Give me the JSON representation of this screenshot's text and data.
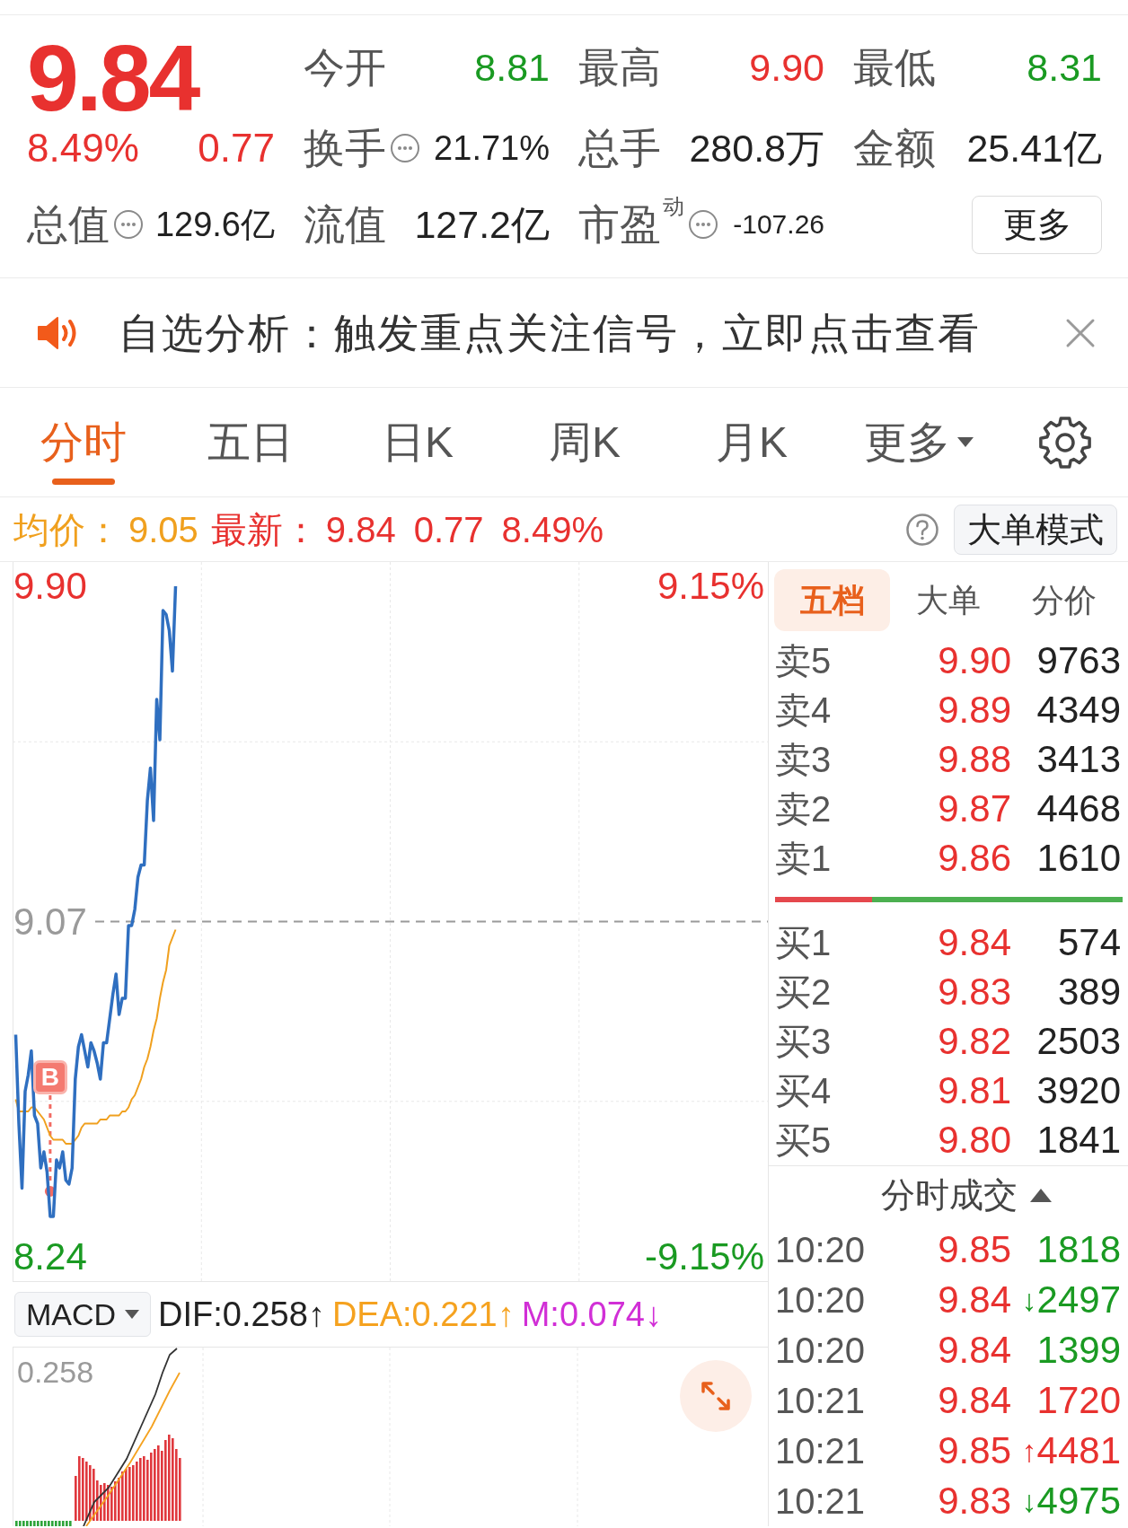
{
  "quote": {
    "price": "9.84",
    "change_pct": "8.49%",
    "change": "0.77",
    "rising": true
  },
  "stats": [
    {
      "label": "今开",
      "info": false,
      "value": "8.81",
      "color": "#1a9a22"
    },
    {
      "label": "最高",
      "info": false,
      "value": "9.90",
      "color": "#e8312f"
    },
    {
      "label": "最低",
      "info": false,
      "value": "8.31",
      "color": "#1a9a22"
    },
    {
      "label": "换手",
      "info": true,
      "value": "21.71%",
      "color": "#222222"
    },
    {
      "label": "总手",
      "info": false,
      "value": "280.8万",
      "color": "#222222"
    },
    {
      "label": "金额",
      "info": false,
      "value": "25.41亿",
      "color": "#222222"
    },
    {
      "label": "总值",
      "info": true,
      "value": "129.6亿",
      "color": "#222222"
    },
    {
      "label": "流值",
      "info": false,
      "value": "127.2亿",
      "color": "#222222"
    },
    {
      "label": "市盈",
      "superscript": "动",
      "info": true,
      "value": "-107.26",
      "color": "#222222"
    }
  ],
  "more_button": "更多",
  "alert": {
    "text": "自选分析：触发重点关注信号，立即点击查看"
  },
  "chart_tabs": [
    {
      "label": "分时",
      "selected": true,
      "dropdown": false
    },
    {
      "label": "五日",
      "selected": false,
      "dropdown": false
    },
    {
      "label": "日K",
      "selected": false,
      "dropdown": false
    },
    {
      "label": "周K",
      "selected": false,
      "dropdown": false
    },
    {
      "label": "月K",
      "selected": false,
      "dropdown": false
    },
    {
      "label": "更多",
      "selected": false,
      "dropdown": true
    }
  ],
  "summary": {
    "average": "9.05",
    "latest": "9.84",
    "change": "0.77",
    "change_pct": "8.49%",
    "mode_button": "大单模式"
  },
  "price_chart": {
    "right_ticks": [
      "9.15%",
      "-9.15%"
    ],
    "chart_data": {
      "type": "line",
      "categories": [
        null,
        null,
        null,
        null,
        null,
        null,
        null,
        null,
        null,
        null,
        null,
        null,
        null,
        null,
        null,
        null,
        null,
        null,
        null,
        null,
        null,
        null,
        null,
        null,
        null,
        null,
        null,
        null,
        null,
        null,
        null,
        null,
        null,
        null,
        null,
        null,
        null,
        null,
        null,
        null,
        null,
        null,
        null,
        null,
        null,
        null,
        null,
        null,
        null,
        null,
        null,
        null,
        null,
        null,
        null,
        null,
        null,
        null,
        null,
        null,
        null,
        null,
        null,
        null,
        null,
        null,
        null,
        null,
        null,
        null,
        null,
        null,
        null,
        null,
        null,
        null,
        null,
        null,
        null,
        null,
        null,
        null,
        null,
        null,
        null,
        null,
        null,
        null,
        null,
        null,
        null,
        null,
        null,
        null,
        null,
        null,
        null,
        null,
        null,
        null,
        null,
        null,
        null,
        null,
        null,
        null,
        null,
        null,
        null,
        null,
        null,
        null,
        null,
        null,
        null,
        null,
        null,
        null,
        null,
        null,
        null,
        null,
        null,
        null,
        null,
        null,
        null,
        null,
        null,
        null,
        null,
        null,
        null,
        null,
        null,
        null,
        null,
        null,
        null,
        null,
        null,
        null,
        null,
        null,
        null,
        null,
        null,
        null,
        null,
        null,
        null,
        null,
        null,
        null,
        null,
        null,
        null,
        null,
        null,
        null,
        null,
        null,
        null,
        null,
        null,
        null,
        null,
        null,
        null,
        null,
        null,
        null,
        null,
        null,
        null,
        null,
        null,
        null,
        null,
        null,
        null,
        null,
        null,
        null,
        null,
        null,
        null,
        null,
        null,
        null,
        null,
        null,
        null,
        null,
        null,
        null,
        null,
        null,
        null,
        null,
        null,
        null,
        null,
        null,
        null,
        null,
        null,
        null,
        null,
        null,
        null,
        null,
        null,
        null,
        null,
        null,
        null,
        null,
        null,
        null,
        null,
        null,
        null,
        null,
        null,
        null,
        null,
        null,
        null,
        null,
        null,
        null,
        null,
        null,
        null,
        null,
        null,
        null,
        null,
        null
      ],
      "ylim": [
        8.18,
        9.96
      ],
      "yticks": [
        {
          "value": 8.24,
          "label": "8.24"
        },
        {
          "value": 9.07,
          "label": "9.07"
        },
        {
          "value": 9.9,
          "label": "9.90"
        }
      ],
      "ref_lines": [
        {
          "axis": "y",
          "value": 9.07
        }
      ],
      "series": [
        {
          "name": "均价：",
          "color": "#f0a01e",
          "values": [
            8.63,
            8.6,
            8.6,
            8.6,
            8.6,
            8.61,
            8.61,
            8.6,
            8.59,
            8.58,
            8.56,
            8.54,
            8.53,
            8.53,
            8.53,
            8.53,
            8.52,
            8.52,
            8.52,
            8.53,
            8.54,
            8.56,
            8.57,
            8.57,
            8.57,
            8.57,
            8.57,
            8.58,
            8.58,
            8.58,
            8.59,
            8.59,
            8.59,
            8.59,
            8.6,
            8.6,
            8.61,
            8.63,
            8.64,
            8.66,
            8.68,
            8.71,
            8.73,
            8.76,
            8.8,
            8.83,
            8.88,
            8.92,
            8.95,
            9.01,
            9.03,
            9.05,
            null,
            null,
            null,
            null,
            null,
            null,
            null,
            null,
            null,
            null,
            null,
            null,
            null,
            null,
            null,
            null,
            null,
            null,
            null,
            null,
            null,
            null,
            null,
            null,
            null,
            null,
            null,
            null,
            null,
            null,
            null,
            null,
            null,
            null,
            null,
            null,
            null,
            null,
            null,
            null,
            null,
            null,
            null,
            null,
            null,
            null,
            null,
            null,
            null,
            null,
            null,
            null,
            null,
            null,
            null,
            null,
            null,
            null,
            null,
            null,
            null,
            null,
            null,
            null,
            null,
            null,
            null,
            null,
            null,
            null,
            null,
            null,
            null,
            null,
            null,
            null,
            null,
            null,
            null,
            null,
            null,
            null,
            null,
            null,
            null,
            null,
            null,
            null,
            null,
            null,
            null,
            null,
            null,
            null,
            null,
            null,
            null,
            null,
            null,
            null,
            null,
            null,
            null,
            null,
            null,
            null,
            null,
            null,
            null,
            null,
            null,
            null,
            null,
            null,
            null,
            null,
            null,
            null,
            null,
            null,
            null,
            null,
            null,
            null,
            null,
            null,
            null,
            null,
            null,
            null,
            null,
            null,
            null,
            null,
            null,
            null,
            null,
            null,
            null,
            null,
            null,
            null,
            null,
            null,
            null,
            null,
            null,
            null,
            null,
            null,
            null,
            null,
            null,
            null,
            null,
            null,
            null,
            null,
            null,
            null,
            null,
            null,
            null,
            null,
            null,
            null,
            null,
            null,
            null,
            null,
            null,
            null,
            null,
            null,
            null,
            null,
            null,
            null,
            null,
            null,
            null,
            null,
            null,
            null,
            null,
            null,
            null,
            null
          ]
        },
        {
          "name": "最新：",
          "color": "#2f6fc0",
          "values": [
            8.79,
            8.57,
            8.41,
            8.65,
            8.69,
            8.75,
            8.59,
            8.57,
            8.46,
            8.5,
            8.45,
            8.34,
            8.34,
            8.48,
            8.46,
            8.5,
            8.43,
            8.42,
            8.46,
            8.68,
            8.76,
            8.79,
            8.75,
            8.71,
            8.77,
            8.75,
            8.72,
            8.68,
            8.77,
            8.77,
            8.83,
            8.89,
            8.94,
            8.84,
            8.88,
            8.88,
            9.06,
            9.06,
            9.1,
            9.18,
            9.21,
            9.21,
            9.37,
            9.45,
            9.32,
            9.62,
            9.52,
            9.84,
            9.83,
            9.79,
            9.69,
            9.9,
            null,
            null,
            null,
            null,
            null,
            null,
            null,
            null,
            null,
            null,
            null,
            null,
            null,
            null,
            null,
            null,
            null,
            null,
            null,
            null,
            null,
            null,
            null,
            null,
            null,
            null,
            null,
            null,
            null,
            null,
            null,
            null,
            null,
            null,
            null,
            null,
            null,
            null,
            null,
            null,
            null,
            null,
            null,
            null,
            null,
            null,
            null,
            null,
            null,
            null,
            null,
            null,
            null,
            null,
            null,
            null,
            null,
            null,
            null,
            null,
            null,
            null,
            null,
            null,
            null,
            null,
            null,
            null,
            null,
            null,
            null,
            null,
            null,
            null,
            null,
            null,
            null,
            null,
            null,
            null,
            null,
            null,
            null,
            null,
            null,
            null,
            null,
            null,
            null,
            null,
            null,
            null,
            null,
            null,
            null,
            null,
            null,
            null,
            null,
            null,
            null,
            null,
            null,
            null,
            null,
            null,
            null,
            null,
            null,
            null,
            null,
            null,
            null,
            null,
            null,
            null,
            null,
            null,
            null,
            null,
            null,
            null,
            null,
            null,
            null,
            null,
            null,
            null,
            null,
            null,
            null,
            null,
            null,
            null,
            null,
            null,
            null,
            null,
            null,
            null,
            null,
            null,
            null,
            null,
            null,
            null,
            null,
            null,
            null,
            null,
            null,
            null,
            null,
            null,
            null,
            null,
            null,
            null,
            null,
            null,
            null,
            null,
            null,
            null,
            null,
            null,
            null,
            null,
            null,
            null,
            null,
            null,
            null,
            null,
            null,
            null,
            null,
            null,
            null,
            null,
            null,
            null,
            null,
            null,
            null,
            null,
            null,
            null
          ]
        }
      ],
      "annotations": [
        "B"
      ]
    }
  },
  "macd": {
    "selector": "MACD",
    "indicators": [
      {
        "text": "DIF:0.258↑",
        "color": "#222222"
      },
      {
        "text": "DEA:0.221↑",
        "color": "#f5a21f"
      },
      {
        "text": "M:0.074↓",
        "color": "#d12fd6"
      }
    ],
    "top_label": "0.258"
  },
  "order_book": {
    "tabs": [
      {
        "label": "五档",
        "selected": true
      },
      {
        "label": "大单",
        "selected": false
      },
      {
        "label": "分价",
        "selected": false
      }
    ],
    "asks": [
      {
        "label": "卖5",
        "price": "9.90",
        "volume": "9763"
      },
      {
        "label": "卖4",
        "price": "9.89",
        "volume": "4349"
      },
      {
        "label": "卖3",
        "price": "9.88",
        "volume": "3413"
      },
      {
        "label": "卖2",
        "price": "9.87",
        "volume": "4468"
      },
      {
        "label": "卖1",
        "price": "9.86",
        "volume": "1610"
      }
    ],
    "ratio": {
      "level": 0.28
    },
    "bids": [
      {
        "label": "买1",
        "price": "9.84",
        "volume": "574"
      },
      {
        "label": "买2",
        "price": "9.83",
        "volume": "389"
      },
      {
        "label": "买3",
        "price": "9.82",
        "volume": "2503"
      },
      {
        "label": "买4",
        "price": "9.81",
        "volume": "3920"
      },
      {
        "label": "买5",
        "price": "9.80",
        "volume": "1841"
      }
    ]
  },
  "trades": {
    "title": "分时成交",
    "expanded": true,
    "rows": [
      {
        "time": "10:20",
        "price": "9.85",
        "volume": "1818",
        "color": "#1a9a22"
      },
      {
        "time": "10:20",
        "price": "9.84",
        "arrow": "↓",
        "volume": "2497",
        "color": "#1a9a22"
      },
      {
        "time": "10:20",
        "price": "9.84",
        "volume": "1399",
        "color": "#1a9a22"
      },
      {
        "time": "10:21",
        "price": "9.84",
        "volume": "1720",
        "color": "#e8312f"
      },
      {
        "time": "10:21",
        "price": "9.85",
        "arrow": "↑",
        "volume": "4481",
        "color": "#e8312f"
      },
      {
        "time": "10:21",
        "price": "9.83",
        "arrow": "↓",
        "volume": "4975",
        "color": "#1a9a22"
      }
    ]
  }
}
